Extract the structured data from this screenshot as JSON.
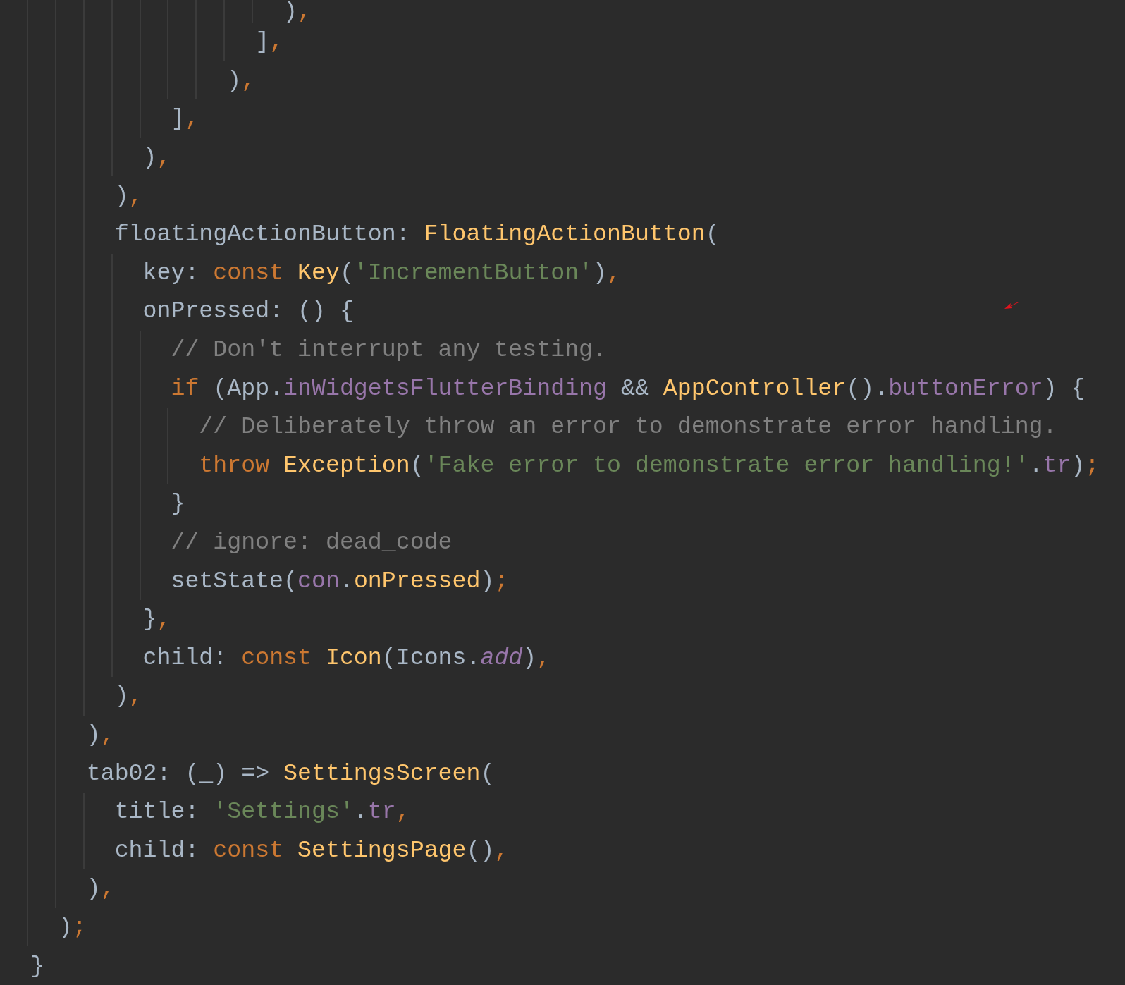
{
  "editor": {
    "lines": [
      {
        "tokens": [
          {
            "kind": "plain",
            "text": "                    )"
          },
          {
            "kind": "punct",
            "text": ","
          }
        ]
      },
      {
        "tokens": [
          {
            "kind": "plain",
            "text": "                  ]"
          },
          {
            "kind": "punct",
            "text": ","
          }
        ]
      },
      {
        "tokens": [
          {
            "kind": "plain",
            "text": "                )"
          },
          {
            "kind": "punct",
            "text": ","
          }
        ]
      },
      {
        "tokens": [
          {
            "kind": "plain",
            "text": "            ]"
          },
          {
            "kind": "punct",
            "text": ","
          }
        ]
      },
      {
        "tokens": [
          {
            "kind": "plain",
            "text": "          )"
          },
          {
            "kind": "punct",
            "text": ","
          }
        ]
      },
      {
        "tokens": [
          {
            "kind": "plain",
            "text": "        )"
          },
          {
            "kind": "punct",
            "text": ","
          }
        ]
      },
      {
        "tokens": [
          {
            "kind": "plain",
            "text": "        floatingActionButton: "
          },
          {
            "kind": "call",
            "text": "FloatingActionButton"
          },
          {
            "kind": "plain",
            "text": "("
          }
        ]
      },
      {
        "tokens": [
          {
            "kind": "plain",
            "text": "          key: "
          },
          {
            "kind": "keyword",
            "text": "const "
          },
          {
            "kind": "call",
            "text": "Key"
          },
          {
            "kind": "plain",
            "text": "("
          },
          {
            "kind": "string",
            "text": "'IncrementButton'"
          },
          {
            "kind": "plain",
            "text": ")"
          },
          {
            "kind": "punct",
            "text": ","
          }
        ]
      },
      {
        "tokens": [
          {
            "kind": "plain",
            "text": "          onPressed: () {"
          }
        ]
      },
      {
        "tokens": [
          {
            "kind": "comment",
            "text": "            // Don't interrupt any testing."
          }
        ]
      },
      {
        "tokens": [
          {
            "kind": "keyword",
            "text": "            if "
          },
          {
            "kind": "plain",
            "text": "(App."
          },
          {
            "kind": "field",
            "text": "inWidgetsFlutterBinding"
          },
          {
            "kind": "plain",
            "text": " && "
          },
          {
            "kind": "call",
            "text": "AppController"
          },
          {
            "kind": "plain",
            "text": "()."
          },
          {
            "kind": "field",
            "text": "buttonError"
          },
          {
            "kind": "plain",
            "text": ") {"
          }
        ]
      },
      {
        "tokens": [
          {
            "kind": "comment",
            "text": "              // Deliberately throw an error to demonstrate error handling."
          }
        ]
      },
      {
        "tokens": [
          {
            "kind": "keyword",
            "text": "              throw "
          },
          {
            "kind": "call",
            "text": "Exception"
          },
          {
            "kind": "plain",
            "text": "("
          },
          {
            "kind": "string",
            "text": "'Fake error to demonstrate error handling!'"
          },
          {
            "kind": "plain",
            "text": "."
          },
          {
            "kind": "field",
            "text": "tr"
          },
          {
            "kind": "plain",
            "text": ")"
          },
          {
            "kind": "punct",
            "text": ";"
          }
        ]
      },
      {
        "tokens": [
          {
            "kind": "plain",
            "text": "            }"
          }
        ]
      },
      {
        "tokens": [
          {
            "kind": "comment",
            "text": "            // ignore: dead_code"
          }
        ]
      },
      {
        "tokens": [
          {
            "kind": "plain",
            "text": "            setState("
          },
          {
            "kind": "field",
            "text": "con"
          },
          {
            "kind": "plain",
            "text": "."
          },
          {
            "kind": "call",
            "text": "onPressed"
          },
          {
            "kind": "plain",
            "text": ")"
          },
          {
            "kind": "punct",
            "text": ";"
          }
        ]
      },
      {
        "tokens": [
          {
            "kind": "plain",
            "text": "          }"
          },
          {
            "kind": "punct",
            "text": ","
          }
        ]
      },
      {
        "tokens": [
          {
            "kind": "plain",
            "text": "          child: "
          },
          {
            "kind": "keyword",
            "text": "const "
          },
          {
            "kind": "call",
            "text": "Icon"
          },
          {
            "kind": "plain",
            "text": "(Icons."
          },
          {
            "kind": "static",
            "text": "add"
          },
          {
            "kind": "plain",
            "text": ")"
          },
          {
            "kind": "punct",
            "text": ","
          }
        ]
      },
      {
        "tokens": [
          {
            "kind": "plain",
            "text": "        )"
          },
          {
            "kind": "punct",
            "text": ","
          }
        ]
      },
      {
        "tokens": [
          {
            "kind": "plain",
            "text": "      )"
          },
          {
            "kind": "punct",
            "text": ","
          }
        ]
      },
      {
        "tokens": [
          {
            "kind": "plain",
            "text": "      tab02: (_) => "
          },
          {
            "kind": "call",
            "text": "SettingsScreen"
          },
          {
            "kind": "plain",
            "text": "("
          }
        ]
      },
      {
        "tokens": [
          {
            "kind": "plain",
            "text": "        title: "
          },
          {
            "kind": "string",
            "text": "'Settings'"
          },
          {
            "kind": "plain",
            "text": "."
          },
          {
            "kind": "field",
            "text": "tr"
          },
          {
            "kind": "punct",
            "text": ","
          }
        ]
      },
      {
        "tokens": [
          {
            "kind": "plain",
            "text": "        child: "
          },
          {
            "kind": "keyword",
            "text": "const "
          },
          {
            "kind": "call",
            "text": "SettingsPage"
          },
          {
            "kind": "plain",
            "text": "()"
          },
          {
            "kind": "punct",
            "text": ","
          }
        ]
      },
      {
        "tokens": [
          {
            "kind": "plain",
            "text": "      )"
          },
          {
            "kind": "punct",
            "text": ","
          }
        ]
      },
      {
        "tokens": [
          {
            "kind": "plain",
            "text": "    )"
          },
          {
            "kind": "punct",
            "text": ";"
          }
        ]
      },
      {
        "tokens": [
          {
            "kind": "plain",
            "text": "  }"
          }
        ]
      }
    ]
  }
}
